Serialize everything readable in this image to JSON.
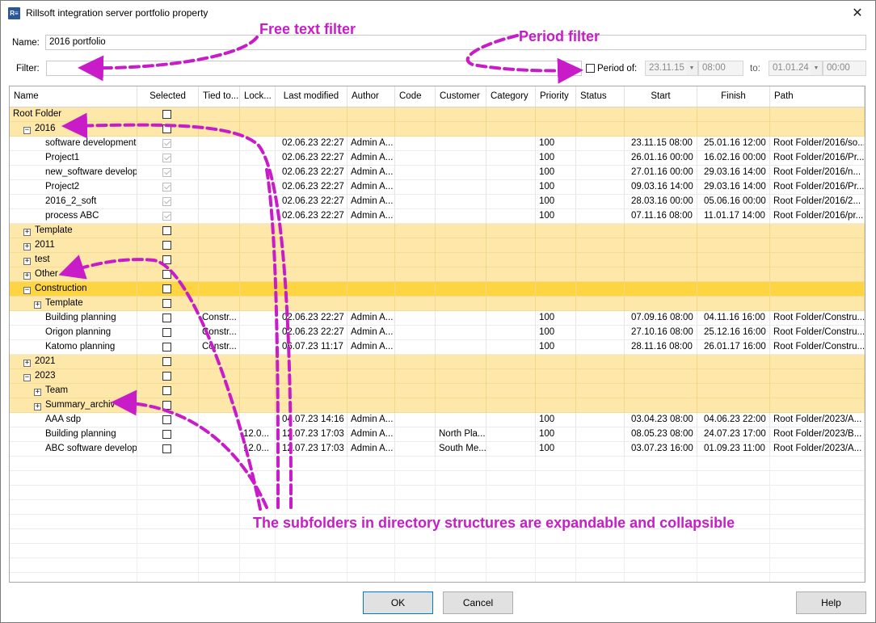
{
  "window": {
    "app_icon": "R≡",
    "title": "Rillsoft integration server portfolio property",
    "close_glyph": "✕"
  },
  "form": {
    "name_label": "Name:",
    "name_value": "2016 portfolio",
    "filter_label": "Filter:",
    "filter_value": "",
    "period_label": "Period of:",
    "period_checked": false,
    "from_date": "23.11.15",
    "from_time": "08:00",
    "to_label": "to:",
    "to_date": "01.01.24",
    "to_time": "00:00"
  },
  "grid": {
    "columns": [
      "Name",
      "Selected",
      "Tied to...",
      "Lock...",
      "Last modified",
      "Author",
      "Code",
      "Customer",
      "Category",
      "Priority",
      "Status",
      "Start",
      "Finish",
      "Path"
    ],
    "rows": [
      {
        "type": "folder",
        "level": 0,
        "expander": "",
        "name": "Root Folder",
        "checked": false
      },
      {
        "type": "folder",
        "level": 1,
        "expander": "−",
        "name": "2016",
        "checked": false
      },
      {
        "type": "item",
        "level": 2,
        "name": "software development p",
        "checked": true,
        "tied": "",
        "lock": "",
        "modified": "02.06.23 22:27",
        "author": "Admin A...",
        "code": "",
        "customer": "",
        "category": "",
        "priority": "100",
        "status": "",
        "start": "23.11.15 08:00",
        "finish": "25.01.16 12:00",
        "path": "Root Folder/2016/so..."
      },
      {
        "type": "item",
        "level": 2,
        "name": "Project1",
        "checked": true,
        "tied": "",
        "lock": "",
        "modified": "02.06.23 22:27",
        "author": "Admin A...",
        "code": "",
        "customer": "",
        "category": "",
        "priority": "100",
        "status": "",
        "start": "26.01.16 00:00",
        "finish": "16.02.16 00:00",
        "path": "Root Folder/2016/Pr..."
      },
      {
        "type": "item",
        "level": 2,
        "name": "new_software developm",
        "checked": true,
        "tied": "",
        "lock": "",
        "modified": "02.06.23 22:27",
        "author": "Admin A...",
        "code": "",
        "customer": "",
        "category": "",
        "priority": "100",
        "status": "",
        "start": "27.01.16 00:00",
        "finish": "29.03.16 14:00",
        "path": "Root Folder/2016/n..."
      },
      {
        "type": "item",
        "level": 2,
        "name": "Project2",
        "checked": true,
        "tied": "",
        "lock": "",
        "modified": "02.06.23 22:27",
        "author": "Admin A...",
        "code": "",
        "customer": "",
        "category": "",
        "priority": "100",
        "status": "",
        "start": "09.03.16 14:00",
        "finish": "29.03.16 14:00",
        "path": "Root Folder/2016/Pr..."
      },
      {
        "type": "item",
        "level": 2,
        "name": "2016_2_soft",
        "checked": true,
        "tied": "",
        "lock": "",
        "modified": "02.06.23 22:27",
        "author": "Admin A...",
        "code": "",
        "customer": "",
        "category": "",
        "priority": "100",
        "status": "",
        "start": "28.03.16 00:00",
        "finish": "05.06.16 00:00",
        "path": "Root Folder/2016/2..."
      },
      {
        "type": "item",
        "level": 2,
        "name": "process ABC",
        "checked": true,
        "tied": "",
        "lock": "",
        "modified": "02.06.23 22:27",
        "author": "Admin A...",
        "code": "",
        "customer": "",
        "category": "",
        "priority": "100",
        "status": "",
        "start": "07.11.16 08:00",
        "finish": "11.01.17 14:00",
        "path": "Root Folder/2016/pr..."
      },
      {
        "type": "folder",
        "level": 1,
        "expander": "+",
        "name": "Template",
        "checked": false
      },
      {
        "type": "folder",
        "level": 1,
        "expander": "+",
        "name": "2011",
        "checked": false
      },
      {
        "type": "folder",
        "level": 1,
        "expander": "+",
        "name": "test",
        "checked": false
      },
      {
        "type": "folder",
        "level": 1,
        "expander": "+",
        "name": "Other",
        "checked": false
      },
      {
        "type": "folder",
        "level": 1,
        "expander": "−",
        "name": "Construction",
        "checked": false,
        "selected": true
      },
      {
        "type": "folder",
        "level": 2,
        "expander": "+",
        "name": "Template",
        "checked": false
      },
      {
        "type": "item",
        "level": 2,
        "name": "Building planning",
        "checked": false,
        "tied": "Constr...",
        "lock": "",
        "modified": "02.06.23 22:27",
        "author": "Admin A...",
        "code": "",
        "customer": "",
        "category": "",
        "priority": "100",
        "status": "",
        "start": "07.09.16 08:00",
        "finish": "04.11.16 16:00",
        "path": "Root Folder/Constru..."
      },
      {
        "type": "item",
        "level": 2,
        "name": "Origon planning",
        "checked": false,
        "tied": "Constr...",
        "lock": "",
        "modified": "02.06.23 22:27",
        "author": "Admin A...",
        "code": "",
        "customer": "",
        "category": "",
        "priority": "100",
        "status": "",
        "start": "27.10.16 08:00",
        "finish": "25.12.16 16:00",
        "path": "Root Folder/Constru..."
      },
      {
        "type": "item",
        "level": 2,
        "name": "Katomo planning",
        "checked": false,
        "tied": "Constr...",
        "lock": "",
        "modified": "06.07.23 11:17",
        "author": "Admin A...",
        "code": "",
        "customer": "",
        "category": "",
        "priority": "100",
        "status": "",
        "start": "28.11.16 08:00",
        "finish": "26.01.17 16:00",
        "path": "Root Folder/Constru..."
      },
      {
        "type": "folder",
        "level": 1,
        "expander": "+",
        "name": "2021",
        "checked": false
      },
      {
        "type": "folder",
        "level": 1,
        "expander": "−",
        "name": "2023",
        "checked": false
      },
      {
        "type": "folder",
        "level": 2,
        "expander": "+",
        "name": "Team",
        "checked": false
      },
      {
        "type": "folder",
        "level": 2,
        "expander": "+",
        "name": "Summary_archiv",
        "checked": false
      },
      {
        "type": "item",
        "level": 2,
        "name": "AAA sdp",
        "checked": false,
        "tied": "",
        "lock": "",
        "modified": "04.07.23 14:16",
        "author": "Admin A...",
        "code": "",
        "customer": "",
        "category": "",
        "priority": "100",
        "status": "",
        "start": "03.04.23 08:00",
        "finish": "04.06.23 22:00",
        "path": "Root Folder/2023/A..."
      },
      {
        "type": "item",
        "level": 2,
        "name": "Building planning",
        "checked": false,
        "tied": "",
        "lock": "12.0...",
        "modified": "12.07.23 17:03",
        "author": "Admin A...",
        "code": "",
        "customer": "North Pla...",
        "category": "",
        "priority": "100",
        "status": "",
        "start": "08.05.23 08:00",
        "finish": "24.07.23 17:00",
        "path": "Root Folder/2023/B..."
      },
      {
        "type": "item",
        "level": 2,
        "name": "ABC software developm",
        "checked": false,
        "tied": "",
        "lock": "12.0...",
        "modified": "12.07.23 17:03",
        "author": "Admin A...",
        "code": "",
        "customer": "South Me...",
        "category": "",
        "priority": "100",
        "status": "",
        "start": "03.07.23 16:00",
        "finish": "01.09.23 11:00",
        "path": "Root Folder/2023/A..."
      }
    ]
  },
  "buttons": {
    "ok": "OK",
    "cancel": "Cancel",
    "help": "Help"
  },
  "annotations": {
    "free_text_filter": "Free text filter",
    "period_filter": "Period filter",
    "subfolders_note": "The subfolders in directory structures are expandable and collapsible",
    "color": "#c81cc8"
  },
  "colors": {
    "folder_row": "#fde8a9",
    "folder_selected": "#fdd542",
    "accent": "#0078d7"
  }
}
